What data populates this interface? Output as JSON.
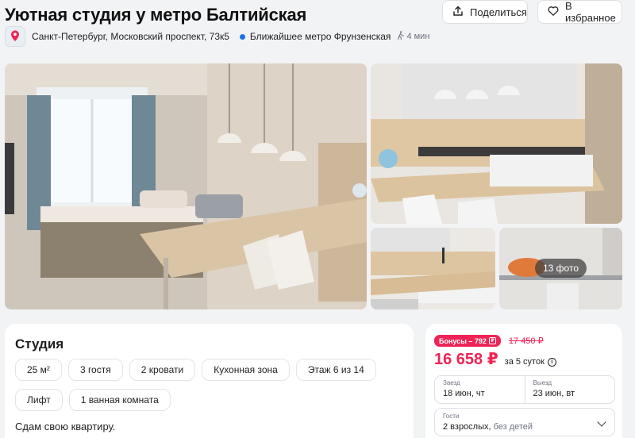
{
  "header": {
    "title": "Уютная студия у метро Балтийская",
    "share_label": "Поделиться",
    "favorite_label": "В избранное"
  },
  "location": {
    "address": "Санкт-Петербург, Московский проспект, 73к5",
    "metro": "Ближайшее метро Фрунзенская",
    "walk_time": "4 мин",
    "metro_color": "#1a73e8"
  },
  "gallery": {
    "photo_count_label": "13 фото"
  },
  "listing": {
    "type": "Студия",
    "features": [
      "25 м²",
      "3 гостя",
      "2 кровати",
      "Кухонная зона",
      "Этаж 6 из 14",
      "Лифт",
      "1 ванная комната"
    ],
    "description": "Сдам свою квартиру."
  },
  "booking": {
    "bonus_label": "Бонусы – 792",
    "old_price": "17 450 ₽",
    "price": "16 658 ₽",
    "per_nights": "за 5 суток",
    "checkin_label": "Заезд",
    "checkin_value": "18 июн, чт",
    "checkout_label": "Выезд",
    "checkout_value": "23 июн, вт",
    "guests_label": "Гости",
    "guests_value": "2 взрослых,",
    "guests_extra": "без детей",
    "accent_color": "#ef2456"
  },
  "icons": [
    "share-icon",
    "heart-icon",
    "map-pin-icon",
    "metro-icon",
    "walking-icon",
    "info-icon",
    "chevron-down-icon",
    "bonus-icon"
  ]
}
